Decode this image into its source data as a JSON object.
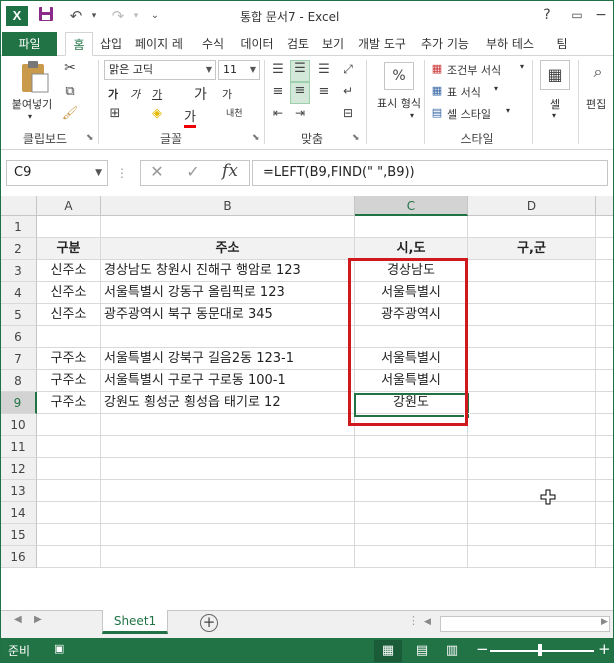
{
  "title": "통합 문서7 - Excel",
  "logo": "X",
  "qat": {
    "save_icon": "save-icon",
    "undo_icon": "undo-icon",
    "redo_icon": "redo-icon"
  },
  "window_controls": {
    "help": "?",
    "restore": "▭",
    "minimize": "−",
    "maximize": "□",
    "close": "✕"
  },
  "tabs": [
    "파일",
    "홈",
    "삽입",
    "페이지 레",
    "수식",
    "데이터",
    "검토",
    "보기",
    "개발 도구",
    "추가 기능",
    "부하 테스",
    "팀"
  ],
  "ribbon": {
    "clipboard": {
      "paste": "붙여넣기",
      "label": "클립보드"
    },
    "font": {
      "name": "맑은 고딕",
      "size": "11",
      "label": "글꼴",
      "bold": "가",
      "italic": "가",
      "underline": "가",
      "grow": "가",
      "shrink": "가",
      "color": "가",
      "phonetic": "내천"
    },
    "align": {
      "label": "맞춤"
    },
    "number": {
      "percent": "%",
      "format": "표시 형식",
      "label": ""
    },
    "styles": {
      "conditional": "조건부 서식",
      "table": "표 서식",
      "cell": "셀 스타일",
      "label": "스타일"
    },
    "cells": {
      "label": "셀"
    },
    "edit": {
      "label": "편집"
    }
  },
  "namebox": "C9",
  "formula": "=LEFT(B9,FIND(\" \",B9))",
  "columns": [
    "A",
    "B",
    "C",
    "D"
  ],
  "rows": [
    "1",
    "2",
    "3",
    "4",
    "5",
    "6",
    "7",
    "8",
    "9",
    "10",
    "11",
    "12",
    "13",
    "14",
    "15",
    "16"
  ],
  "headers": {
    "a": "구분",
    "b": "주소",
    "c": "시,도",
    "d": "구,군"
  },
  "data_rows": [
    {
      "a": "신주소",
      "b": "경상남도 창원시 진해구 행암로 123",
      "c": "경상남도"
    },
    {
      "a": "신주소",
      "b": "서울특별시 강동구 올림픽로 123",
      "c": "서울특별시"
    },
    {
      "a": "신주소",
      "b": "광주광역시 북구 동문대로 345",
      "c": "광주광역시"
    },
    {
      "a": "",
      "b": "",
      "c": ""
    },
    {
      "a": "구주소",
      "b": "서울특별시 강북구 길음2동 123-1",
      "c": "서울특별시"
    },
    {
      "a": "구주소",
      "b": "서울특별시 구로구 구로동 100-1",
      "c": "서울특별시"
    },
    {
      "a": "구주소",
      "b": "강원도 횡성군 횡성읍 태기로 12",
      "c": "강원도"
    }
  ],
  "sheet": "Sheet1",
  "status": "준비",
  "colors": {
    "excel_green": "#217346",
    "highlight_red": "#d0191d"
  }
}
